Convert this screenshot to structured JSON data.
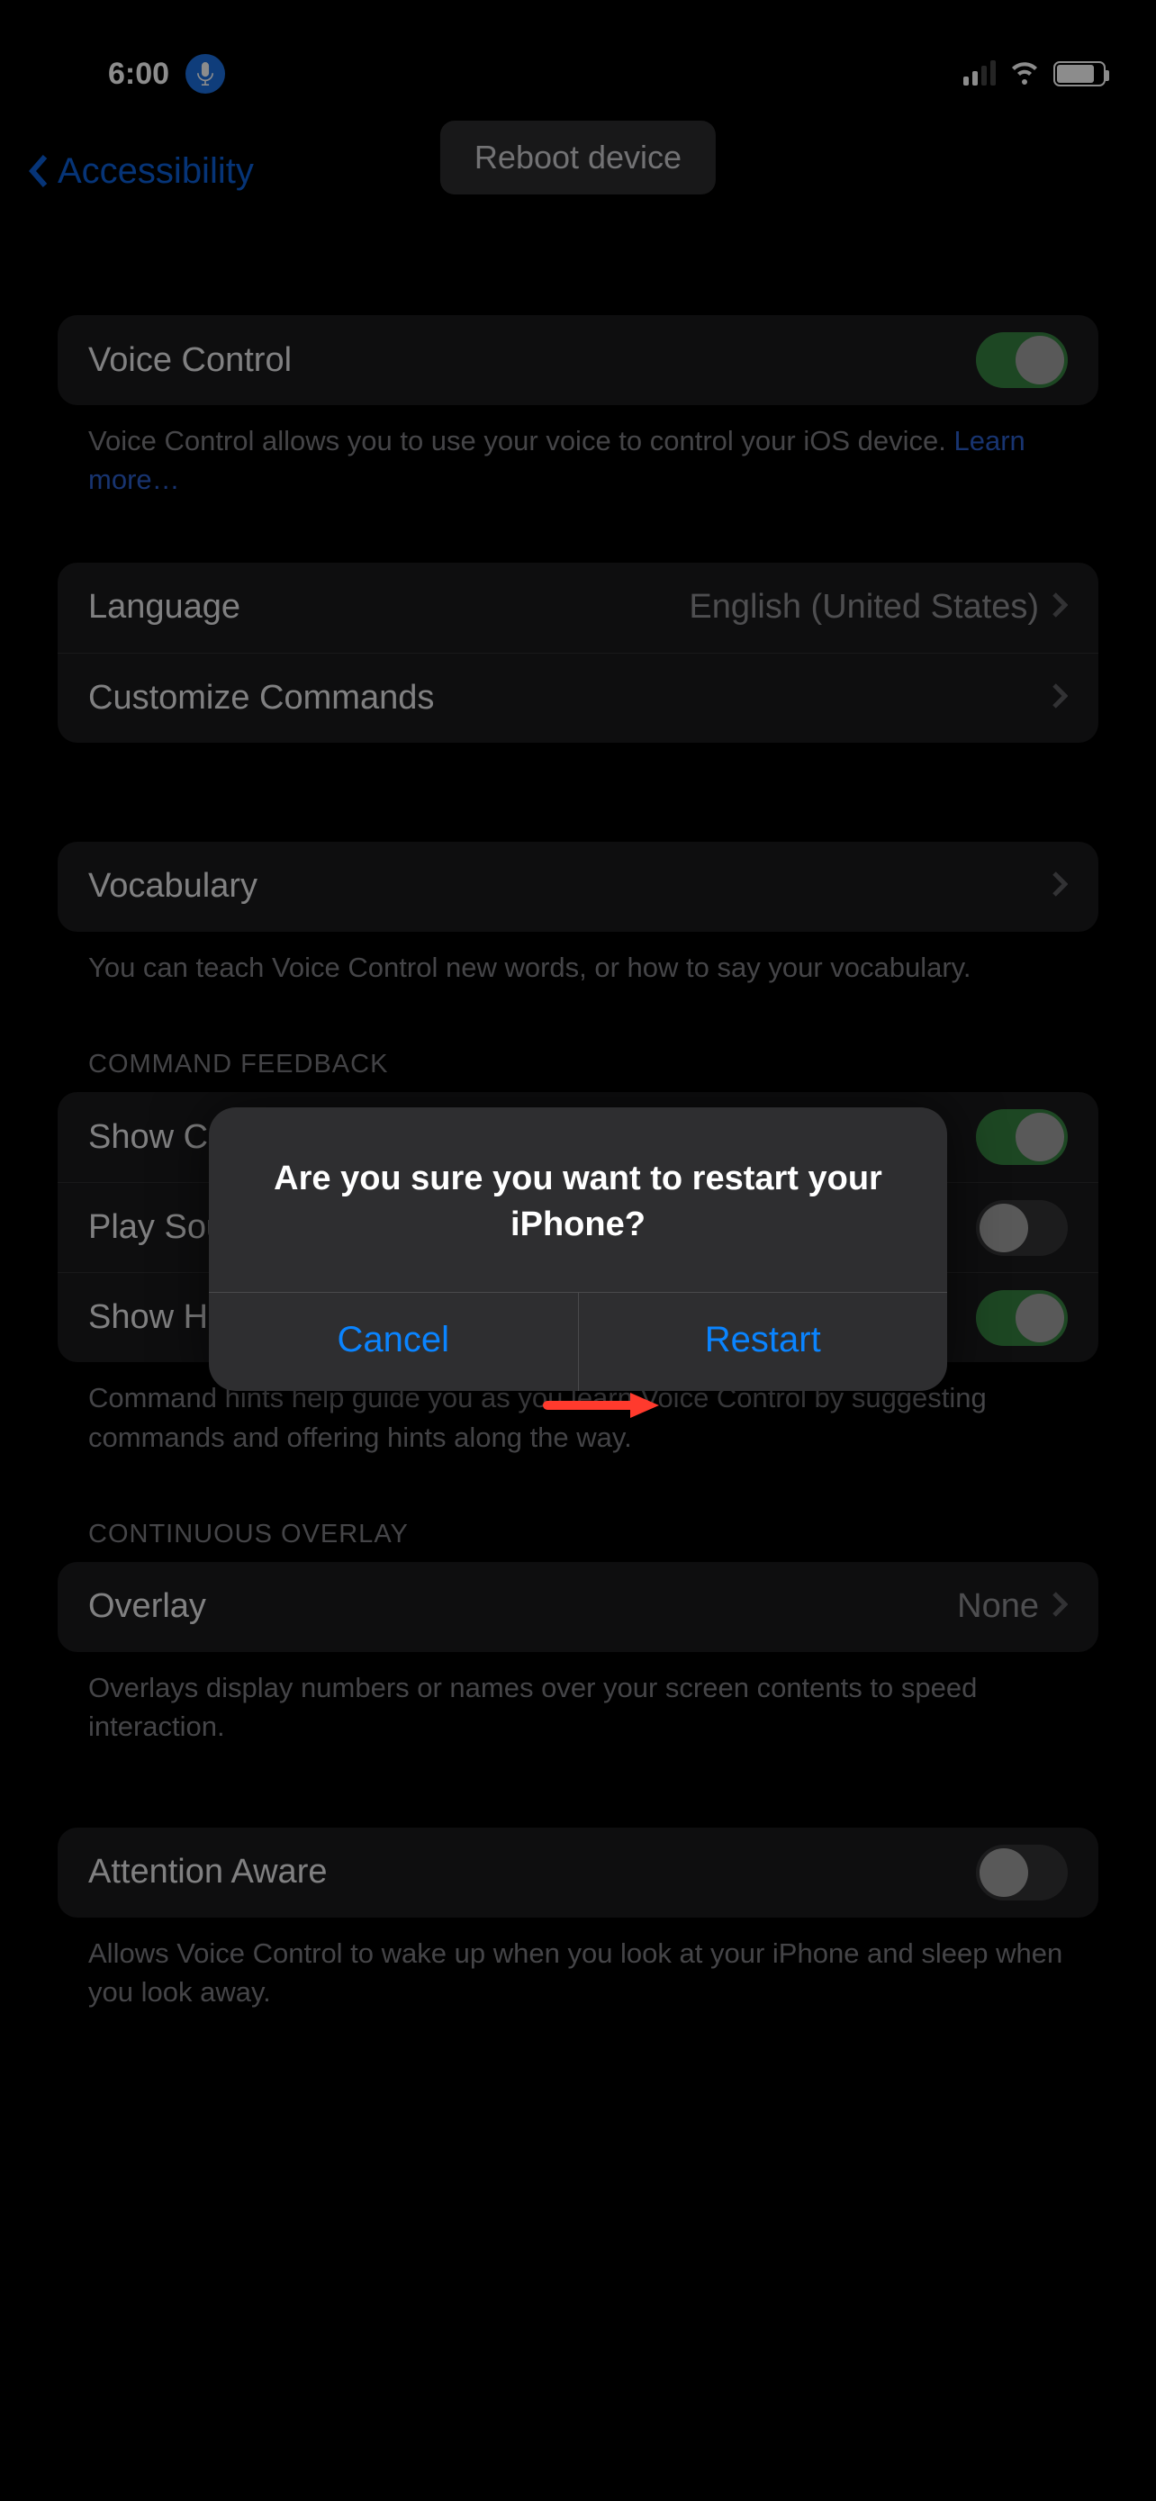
{
  "statusbar": {
    "time": "6:00"
  },
  "nav": {
    "back_label": "Accessibility",
    "tooltip": "Reboot device"
  },
  "voice_control": {
    "label": "Voice Control",
    "footer_prefix": "Voice Control allows you to use your voice to control your iOS device. ",
    "learn_more": "Learn more…"
  },
  "language_row": {
    "label": "Language",
    "value": "English (United States)"
  },
  "customize_row": {
    "label": "Customize Commands"
  },
  "vocabulary": {
    "label": "Vocabulary",
    "footer": "You can teach Voice Control new words, or how to say your vocabulary."
  },
  "feedback": {
    "header": "COMMAND FEEDBACK",
    "show_confirmation": "Show Confirmation",
    "play_sound": "Play Sound",
    "show_hints": "Show Hints",
    "footer": "Command hints help guide you as you learn Voice Control by suggesting commands and offering hints along the way."
  },
  "overlay": {
    "header": "CONTINUOUS OVERLAY",
    "label": "Overlay",
    "value": "None",
    "footer": "Overlays display numbers or names over your screen contents to speed interaction."
  },
  "attention": {
    "label": "Attention Aware",
    "footer": "Allows Voice Control to wake up when you look at your iPhone and sleep when you look away."
  },
  "modal": {
    "title": "Are you sure you want to restart your iPhone?",
    "cancel": "Cancel",
    "restart": "Restart"
  }
}
